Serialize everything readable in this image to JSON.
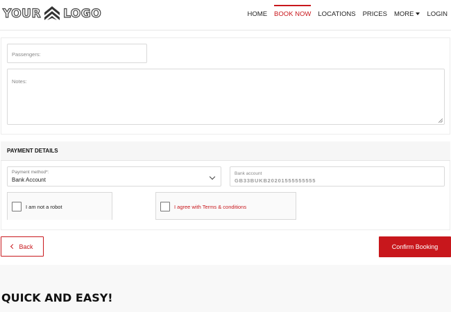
{
  "logo": {
    "left_text": "YOUR",
    "right_text": "LOGO",
    "mark_icon": "chevrons-up-icon"
  },
  "nav": {
    "items": [
      {
        "label": "HOME",
        "active": false
      },
      {
        "label": "BOOK NOW",
        "active": true
      },
      {
        "label": "LOCATIONS",
        "active": false
      },
      {
        "label": "PRICES",
        "active": false
      },
      {
        "label": "MORE",
        "active": false,
        "has_caret": true
      },
      {
        "label": "LOGIN",
        "active": false
      }
    ]
  },
  "form": {
    "passengers_placeholder": "Passengers:",
    "notes_placeholder": "Notes:"
  },
  "payment": {
    "title": "PAYMENT DETAILS",
    "method_label": "Payment method*:",
    "method_value": "Bank Account",
    "bank_label": "Bank account",
    "bank_value": "GB33BUKB20201555555555",
    "robot_label": "I am not a robot",
    "terms_label": "I agree with Terms & conditions"
  },
  "actions": {
    "back_label": "Back",
    "confirm_label": "Confirm Booking"
  },
  "footer_section": {
    "title": "QUICK AND EASY!"
  },
  "colors": {
    "accent": "#c8171c"
  }
}
